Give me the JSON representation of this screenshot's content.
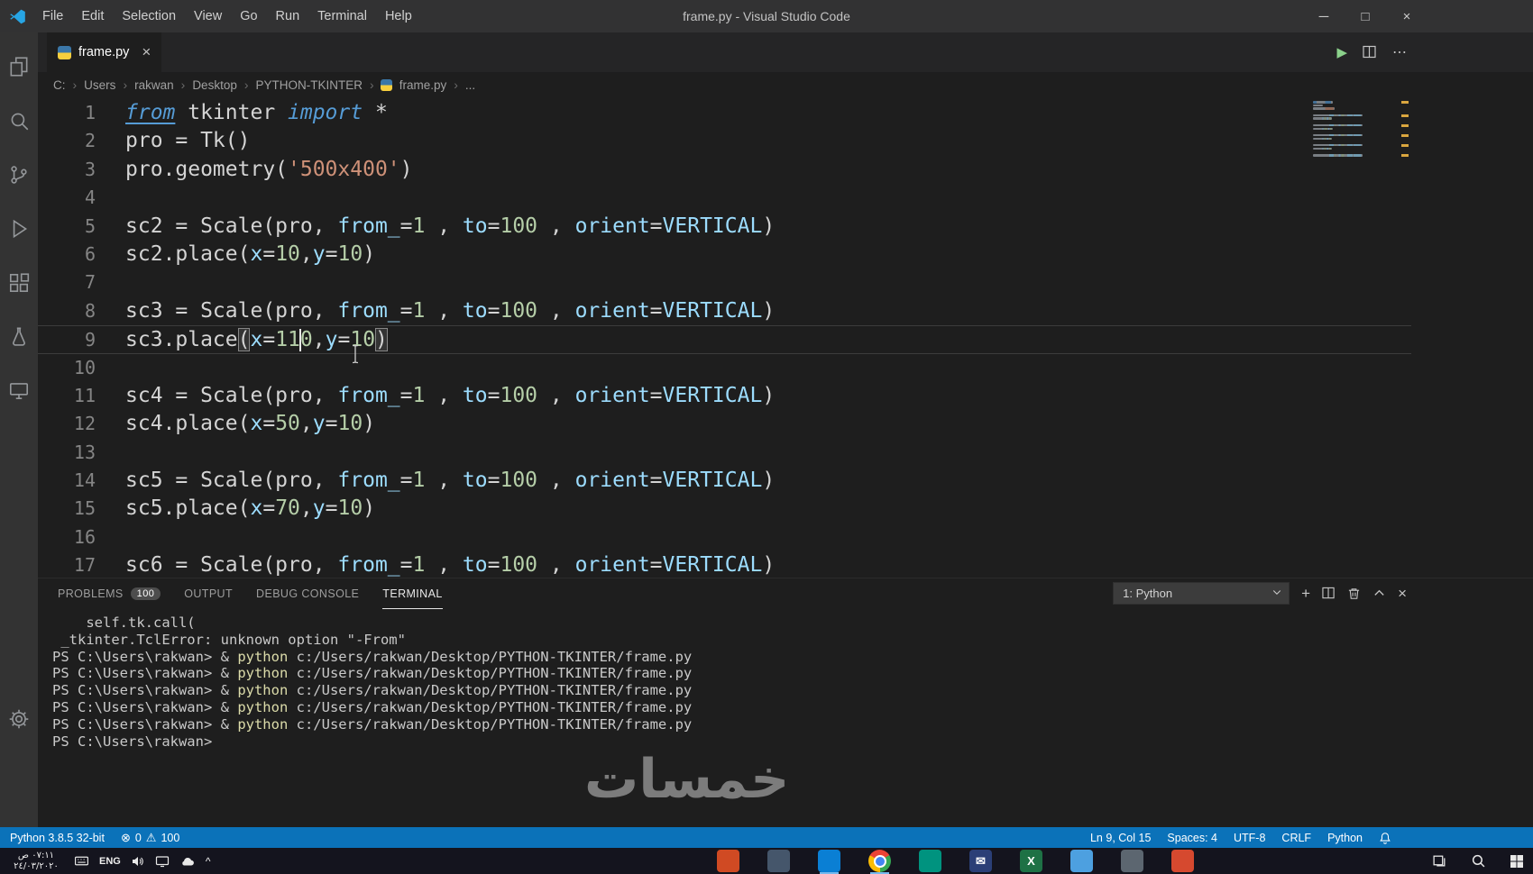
{
  "titlebar": {
    "title": "frame.py - Visual Studio Code",
    "menus": [
      "File",
      "Edit",
      "Selection",
      "View",
      "Go",
      "Run",
      "Terminal",
      "Help"
    ]
  },
  "tabbar": {
    "active_tab": "frame.py"
  },
  "breadcrumb": {
    "items": [
      "C:",
      "Users",
      "rakwan",
      "Desktop",
      "PYTHON-TKINTER",
      "frame.py",
      "..."
    ]
  },
  "activity_bar": {
    "items": [
      "explorer",
      "search",
      "source-control",
      "run-debug",
      "extensions",
      "test",
      "remote-explorer"
    ],
    "bottom": [
      "settings"
    ]
  },
  "editor": {
    "lines": [
      {
        "n": 1,
        "tokens": [
          [
            "ku",
            "from"
          ],
          [
            "p",
            " tkinter "
          ],
          [
            "k",
            "import"
          ],
          [
            "p",
            " *"
          ]
        ]
      },
      {
        "n": 2,
        "tokens": [
          [
            "p",
            "pro = Tk()"
          ]
        ]
      },
      {
        "n": 3,
        "tokens": [
          [
            "p",
            "pro.geometry("
          ],
          [
            "s",
            "'500x400'"
          ],
          [
            "p",
            ")"
          ]
        ]
      },
      {
        "n": 4,
        "tokens": []
      },
      {
        "n": 5,
        "tokens": [
          [
            "p",
            "sc2 = Scale(pro, "
          ],
          [
            "i",
            "from_"
          ],
          [
            "p",
            "="
          ],
          [
            "n",
            "1"
          ],
          [
            "p",
            " , "
          ],
          [
            "i",
            "to"
          ],
          [
            "p",
            "="
          ],
          [
            "n",
            "100"
          ],
          [
            "p",
            " , "
          ],
          [
            "i",
            "orient"
          ],
          [
            "p",
            "="
          ],
          [
            "i",
            "VERTICAL"
          ],
          [
            "p",
            ")"
          ]
        ]
      },
      {
        "n": 6,
        "tokens": [
          [
            "p",
            "sc2.place("
          ],
          [
            "i",
            "x"
          ],
          [
            "p",
            "="
          ],
          [
            "n",
            "10"
          ],
          [
            "p",
            ","
          ],
          [
            "i",
            "y"
          ],
          [
            "p",
            "="
          ],
          [
            "n",
            "10"
          ],
          [
            "p",
            ")"
          ]
        ]
      },
      {
        "n": 7,
        "tokens": []
      },
      {
        "n": 8,
        "tokens": [
          [
            "p",
            "sc3 = Scale(pro, "
          ],
          [
            "i",
            "from_"
          ],
          [
            "p",
            "="
          ],
          [
            "n",
            "1"
          ],
          [
            "p",
            " , "
          ],
          [
            "i",
            "to"
          ],
          [
            "p",
            "="
          ],
          [
            "n",
            "100"
          ],
          [
            "p",
            " , "
          ],
          [
            "i",
            "orient"
          ],
          [
            "p",
            "="
          ],
          [
            "i",
            "VERTICAL"
          ],
          [
            "p",
            ")"
          ]
        ]
      },
      {
        "n": 9,
        "current": true,
        "tokens": [
          [
            "p",
            "sc3.place"
          ],
          [
            "b",
            "("
          ],
          [
            "i",
            "x"
          ],
          [
            "p",
            "="
          ],
          [
            "n",
            "11"
          ],
          [
            "c",
            ""
          ],
          [
            "n",
            "0"
          ],
          [
            "p",
            ","
          ],
          [
            "i",
            "y"
          ],
          [
            "p",
            "="
          ],
          [
            "n",
            "10"
          ],
          [
            "b",
            ")"
          ]
        ]
      },
      {
        "n": 10,
        "tokens": []
      },
      {
        "n": 11,
        "tokens": [
          [
            "p",
            "sc4 = Scale(pro, "
          ],
          [
            "i",
            "from_"
          ],
          [
            "p",
            "="
          ],
          [
            "n",
            "1"
          ],
          [
            "p",
            " , "
          ],
          [
            "i",
            "to"
          ],
          [
            "p",
            "="
          ],
          [
            "n",
            "100"
          ],
          [
            "p",
            " , "
          ],
          [
            "i",
            "orient"
          ],
          [
            "p",
            "="
          ],
          [
            "i",
            "VERTICAL"
          ],
          [
            "p",
            ")"
          ]
        ]
      },
      {
        "n": 12,
        "tokens": [
          [
            "p",
            "sc4.place("
          ],
          [
            "i",
            "x"
          ],
          [
            "p",
            "="
          ],
          [
            "n",
            "50"
          ],
          [
            "p",
            ","
          ],
          [
            "i",
            "y"
          ],
          [
            "p",
            "="
          ],
          [
            "n",
            "10"
          ],
          [
            "p",
            ")"
          ]
        ]
      },
      {
        "n": 13,
        "tokens": []
      },
      {
        "n": 14,
        "tokens": [
          [
            "p",
            "sc5 = Scale(pro, "
          ],
          [
            "i",
            "from_"
          ],
          [
            "p",
            "="
          ],
          [
            "n",
            "1"
          ],
          [
            "p",
            " , "
          ],
          [
            "i",
            "to"
          ],
          [
            "p",
            "="
          ],
          [
            "n",
            "100"
          ],
          [
            "p",
            " , "
          ],
          [
            "i",
            "orient"
          ],
          [
            "p",
            "="
          ],
          [
            "i",
            "VERTICAL"
          ],
          [
            "p",
            ")"
          ]
        ]
      },
      {
        "n": 15,
        "tokens": [
          [
            "p",
            "sc5.place("
          ],
          [
            "i",
            "x"
          ],
          [
            "p",
            "="
          ],
          [
            "n",
            "70"
          ],
          [
            "p",
            ","
          ],
          [
            "i",
            "y"
          ],
          [
            "p",
            "="
          ],
          [
            "n",
            "10"
          ],
          [
            "p",
            ")"
          ]
        ]
      },
      {
        "n": 16,
        "tokens": []
      },
      {
        "n": 17,
        "tokens": [
          [
            "p",
            "sc6 = Scale(pro, "
          ],
          [
            "i",
            "from_"
          ],
          [
            "p",
            "="
          ],
          [
            "n",
            "1"
          ],
          [
            "p",
            " , "
          ],
          [
            "i",
            "to"
          ],
          [
            "p",
            "="
          ],
          [
            "n",
            "100"
          ],
          [
            "p",
            " , "
          ],
          [
            "i",
            "orient"
          ],
          [
            "p",
            "="
          ],
          [
            "i",
            "VERTICAL"
          ],
          [
            "p",
            ")"
          ]
        ]
      }
    ],
    "warning_lines": [
      1,
      5,
      8,
      11,
      14,
      17
    ]
  },
  "panel": {
    "tabs": [
      {
        "label": "PROBLEMS",
        "badge": "100"
      },
      {
        "label": "OUTPUT"
      },
      {
        "label": "DEBUG CONSOLE"
      },
      {
        "label": "TERMINAL",
        "active": true
      }
    ],
    "dropdown_value": "1: Python"
  },
  "terminal": {
    "lines": [
      [
        [
          "w",
          "    self.tk.call("
        ]
      ],
      [
        [
          "w",
          " _tkinter.TclError: unknown option \"-From\""
        ]
      ],
      [
        [
          "w",
          "PS C:\\Users\\rakwan> & "
        ],
        [
          "y",
          "python"
        ],
        [
          "w",
          " c:/Users/rakwan/Desktop/PYTHON-TKINTER/frame.py"
        ]
      ],
      [
        [
          "w",
          "PS C:\\Users\\rakwan> & "
        ],
        [
          "y",
          "python"
        ],
        [
          "w",
          " c:/Users/rakwan/Desktop/PYTHON-TKINTER/frame.py"
        ]
      ],
      [
        [
          "w",
          "PS C:\\Users\\rakwan> & "
        ],
        [
          "y",
          "python"
        ],
        [
          "w",
          " c:/Users/rakwan/Desktop/PYTHON-TKINTER/frame.py"
        ]
      ],
      [
        [
          "w",
          "PS C:\\Users\\rakwan> & "
        ],
        [
          "y",
          "python"
        ],
        [
          "w",
          " c:/Users/rakwan/Desktop/PYTHON-TKINTER/frame.py"
        ]
      ],
      [
        [
          "w",
          "PS C:\\Users\\rakwan> & "
        ],
        [
          "y",
          "python"
        ],
        [
          "w",
          " c:/Users/rakwan/Desktop/PYTHON-TKINTER/frame.py"
        ]
      ],
      [
        [
          "w",
          "PS C:\\Users\\rakwan>"
        ]
      ]
    ]
  },
  "statusbar": {
    "python_version": "Python 3.8.5 32-bit",
    "errors": "0",
    "warnings": "100",
    "line_col": "Ln 9, Col 15",
    "indent": "Spaces: 4",
    "encoding": "UTF-8",
    "eol": "CRLF",
    "language": "Python"
  },
  "taskbar": {
    "time": "٠٧:١١ ص",
    "date": "٢٤/٠٣/٢٠٢٠",
    "input_lang": "ENG",
    "apps": [
      {
        "name": "office-app",
        "color": "#d04a23"
      },
      {
        "name": "files-app",
        "color": "#45566b"
      },
      {
        "name": "vscode",
        "color": "#0a7fd4",
        "active": true
      },
      {
        "name": "chrome",
        "color": "conic",
        "active": true
      },
      {
        "name": "teams-app",
        "color": "#00937f"
      },
      {
        "name": "mail-app",
        "color": "#2b3f77",
        "glyph": "✉"
      },
      {
        "name": "excel",
        "color": "#1e7145",
        "glyph": "X"
      },
      {
        "name": "this-pc",
        "color": "#4da0e0"
      },
      {
        "name": "defender",
        "color": "#5c6670"
      },
      {
        "name": "opera-app",
        "color": "#d6492f"
      }
    ]
  },
  "watermark": {
    "text": "خمسات"
  },
  "icons": {
    "error": "⊗",
    "warning": "⚠",
    "run": "▶",
    "more": "⋯",
    "close": "×",
    "minimize": "─",
    "maximize": "□",
    "plus": "+",
    "breadcrumb_separator": "›",
    "tray_chevron": "^"
  }
}
